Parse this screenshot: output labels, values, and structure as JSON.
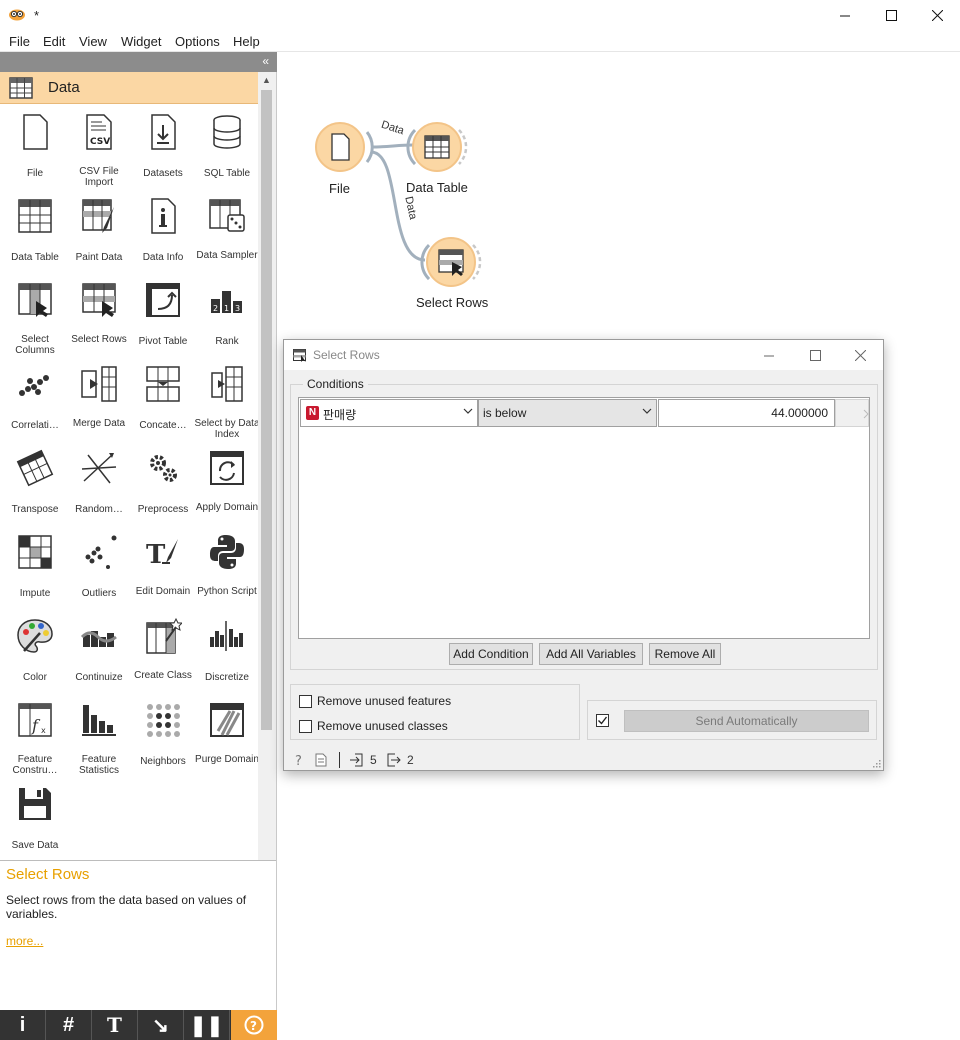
{
  "window": {
    "title": "*"
  },
  "menu": [
    {
      "label": "File"
    },
    {
      "label": "Edit"
    },
    {
      "label": "View"
    },
    {
      "label": "Widget"
    },
    {
      "label": "Options"
    },
    {
      "label": "Help"
    }
  ],
  "dock": {
    "category": "Data",
    "tools": [
      {
        "label": "File",
        "icon": "file-icon"
      },
      {
        "label": "CSV File Import",
        "icon": "csv-icon"
      },
      {
        "label": "Datasets",
        "icon": "download-icon"
      },
      {
        "label": "SQL Table",
        "icon": "database-icon"
      },
      {
        "label": "Data Table",
        "icon": "table-icon"
      },
      {
        "label": "Paint Data",
        "icon": "paint-icon"
      },
      {
        "label": "Data Info",
        "icon": "info-icon"
      },
      {
        "label": "Data Sampler",
        "icon": "sampler-icon"
      },
      {
        "label": "Select Columns",
        "icon": "select-columns-icon"
      },
      {
        "label": "Select Rows",
        "icon": "select-rows-icon"
      },
      {
        "label": "Pivot Table",
        "icon": "pivot-icon"
      },
      {
        "label": "Rank",
        "icon": "rank-icon"
      },
      {
        "label": "Correlati…",
        "icon": "correlations-icon"
      },
      {
        "label": "Merge Data",
        "icon": "merge-icon"
      },
      {
        "label": "Concate…",
        "icon": "concatenate-icon"
      },
      {
        "label": "Select by Data Index",
        "icon": "select-by-index-icon"
      },
      {
        "label": "Transpose",
        "icon": "transpose-icon"
      },
      {
        "label": "Random…",
        "icon": "randomize-icon"
      },
      {
        "label": "Preprocess",
        "icon": "gears-icon"
      },
      {
        "label": "Apply Domain",
        "icon": "apply-domain-icon"
      },
      {
        "label": "Impute",
        "icon": "impute-icon"
      },
      {
        "label": "Outliers",
        "icon": "outliers-icon"
      },
      {
        "label": "Edit Domain",
        "icon": "edit-domain-icon"
      },
      {
        "label": "Python Script",
        "icon": "python-icon"
      },
      {
        "label": "Color",
        "icon": "palette-icon"
      },
      {
        "label": "Continuize",
        "icon": "continuize-icon"
      },
      {
        "label": "Create Class",
        "icon": "create-class-icon"
      },
      {
        "label": "Discretize",
        "icon": "discretize-icon"
      },
      {
        "label": "Feature Constru…",
        "icon": "feature-constructor-icon"
      },
      {
        "label": "Feature Statistics",
        "icon": "feature-statistics-icon"
      },
      {
        "label": "Neighbors",
        "icon": "neighbors-icon"
      },
      {
        "label": "Purge Domain",
        "icon": "purge-domain-icon"
      },
      {
        "label": "Save Data",
        "icon": "save-icon"
      }
    ],
    "description": {
      "title": "Select Rows",
      "text": "Select rows from the data based on values of variables.",
      "more": "more..."
    }
  },
  "canvas": {
    "nodes": [
      {
        "label": "File"
      },
      {
        "label": "Data Table"
      },
      {
        "label": "Select Rows"
      }
    ],
    "links": [
      {
        "label": "Data"
      },
      {
        "label": "Data"
      }
    ]
  },
  "dialog": {
    "title": "Select Rows",
    "conditions_label": "Conditions",
    "condition": {
      "variable": "판매량",
      "operator": "is below",
      "value": "44.000000"
    },
    "buttons": {
      "add_condition": "Add Condition",
      "add_all": "Add All Variables",
      "remove_all": "Remove All"
    },
    "options": {
      "remove_features": "Remove unused features",
      "remove_classes": "Remove unused classes"
    },
    "send": {
      "label": "Send Automatically",
      "checked": true
    },
    "status": {
      "input_count": "5",
      "output_count": "2"
    }
  },
  "colors": {
    "accent": "#f3a33b",
    "node_fill": "#fbd7a4",
    "node_ring": "#a8b8c8"
  }
}
